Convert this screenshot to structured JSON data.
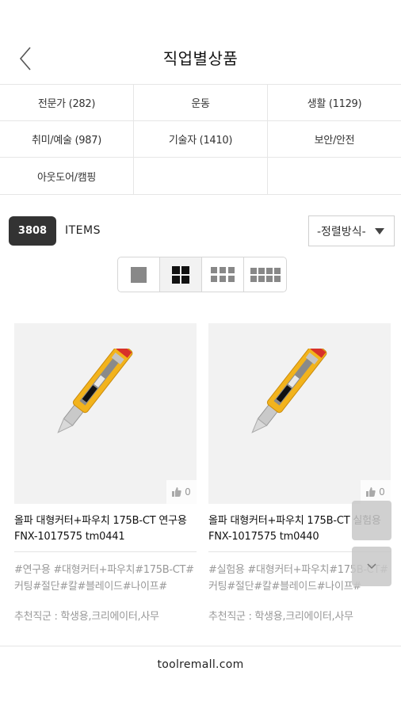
{
  "header": {
    "title": "직업별상품"
  },
  "categories": [
    {
      "label": "전문가 (282)"
    },
    {
      "label": "운동"
    },
    {
      "label": "생활 (1129)"
    },
    {
      "label": "취미/예술 (987)"
    },
    {
      "label": "기술자 (1410)"
    },
    {
      "label": "보안/안전"
    },
    {
      "label": "아웃도어/캠핑"
    },
    {
      "label": ""
    },
    {
      "label": ""
    }
  ],
  "toolbar": {
    "count": "3808",
    "items_label": "ITEMS",
    "sort_label": "-정렬방식-",
    "view_modes": [
      "list-1",
      "grid-2",
      "grid-3",
      "grid-4"
    ],
    "active_view": "grid-2"
  },
  "products": [
    {
      "name": "올파 대형커터+파우치 175B-CT 연구용 FNX-1017575 tm0441",
      "tags": "#연구용 #대형커터+파우치#175B-CT#커팅#절단#칼#블레이드#나이프#",
      "recommend": "추천직군 : 학생용,크리에이터,사무",
      "likes": "0"
    },
    {
      "name": "올파 대형커터+파우치 175B-CT 실험용 FNX-1017575 tm0440",
      "tags": "#실험용 #대형커터+파우치#175B-CT#커팅#절단#칼#블레이드#나이프#",
      "recommend": "추천직군 : 학생용,크리에이터,사무",
      "likes": "0"
    }
  ],
  "footer": {
    "domain": "toolremall.com"
  },
  "colors": {
    "badge_bg": "#333333",
    "cutter_yellow": "#f2b31c",
    "accent_red": "#d8312a"
  }
}
